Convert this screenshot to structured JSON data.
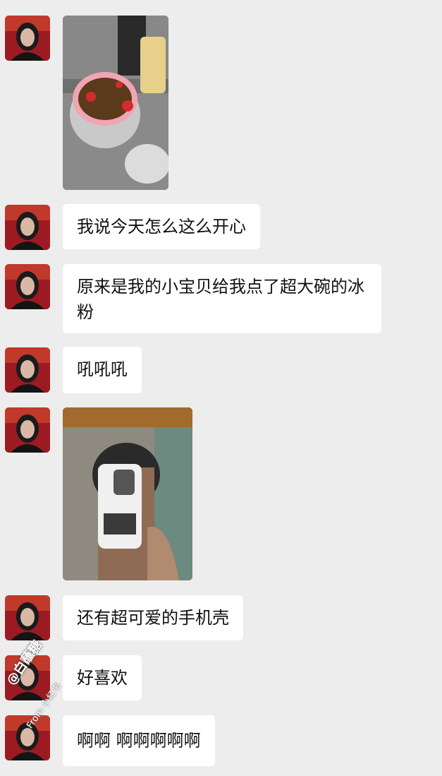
{
  "chat": {
    "messages": [
      {
        "type": "image",
        "image_name": "food-bowl-photo"
      },
      {
        "type": "text",
        "text": "我说今天怎么这么开心"
      },
      {
        "type": "text",
        "text": "原来是我的小宝贝给我点了超大碗的冰粉"
      },
      {
        "type": "text",
        "text": "吼吼吼"
      },
      {
        "type": "image",
        "image_name": "phone-case-selfie-photo"
      },
      {
        "type": "text",
        "text": "还有超可爱的手机壳"
      },
      {
        "type": "text",
        "text": "好喜欢"
      },
      {
        "type": "text",
        "text": "啊啊 啊啊啊啊啊"
      }
    ]
  },
  "watermark": {
    "name": "@白蘸糖",
    "source": "From 小红书"
  },
  "colors": {
    "background": "#ededed",
    "bubble": "#ffffff",
    "text": "#111111",
    "avatar_bg": "#a31a1f"
  },
  "icons": {
    "avatar": "avatar"
  }
}
